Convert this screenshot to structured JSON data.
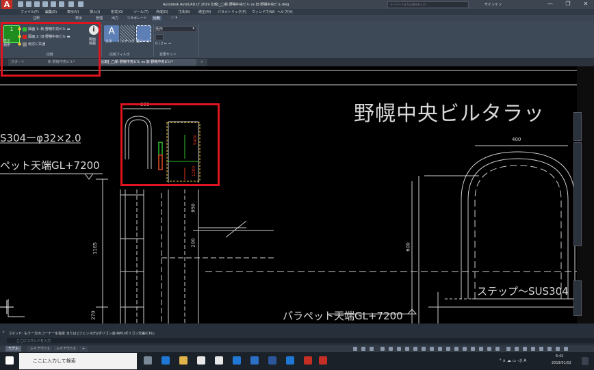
{
  "window": {
    "title": "Autodesk AutoCAD LT 2019   比較[_◯新-野幌中央ビル vs 旧-野幌中央ビル.dwg",
    "search_placeholder": "キーワードまたは語句を入力",
    "signin": "サインイン",
    "controls": [
      "—",
      "❐",
      "✕"
    ]
  },
  "menu": [
    "ファイル(F)",
    "編集(E)",
    "表示(V)",
    "挿入(I)",
    "形式(O)",
    "ツール(T)",
    "作成(D)",
    "寸法(N)",
    "修正(M)",
    "パラメトリック(P)",
    "ウィンドウ(W)",
    "ヘルプ(H)"
  ],
  "ribbon_tabs": [
    "注釈",
    "表示",
    "管理",
    "出力",
    "コラボレート",
    "比較"
  ],
  "ribbon": {
    "compare_panel": {
      "toggle_label": "表示\n順序",
      "drawing1": "図面 1: 新-野幌中央ビル",
      "drawing2": "図面 2: 旧-野幌中央ビル",
      "both": "両方に共通",
      "info_label": "図面\n情報",
      "panel_title": "比較",
      "colors": {
        "drawing1": "#2fbf2f",
        "drawing2": "#d8231a",
        "both": "#888888"
      }
    },
    "filter_panel": {
      "text_label": "文字",
      "hatch_label": "ハッチング",
      "revcloud_label": "雲マーク",
      "panel_title": "比較フィルタ"
    },
    "changeset_panel": {
      "shape_value": "矩形",
      "counter": "0 / 2",
      "panel_title": "変更セット"
    }
  },
  "doc_tabs": [
    {
      "label": "スタート",
      "active": false
    },
    {
      "label": "新-野幌中央ビル*",
      "active": false
    },
    {
      "label": "比較[_◯新-野幌中央ビル vs 旧-野幌中央ビル*",
      "active": true
    }
  ],
  "drawing": {
    "title_text": "野幌中央ビルタラッ",
    "leader_text": "S304ーφ32×2.0",
    "parapet_left": "ペット天端GL+7200",
    "parapet_bottom": "パラペット天端GL+7200",
    "step_text": "ステップ～SUS304",
    "dims": [
      "300",
      "5400",
      "1200",
      "950",
      "200",
      "1165",
      "270",
      "400",
      "600"
    ]
  },
  "command": {
    "history": "コマンド: もう一方のコーナーを指定 または [フェンス(F)/ポリゴン窓(WP)/ポリゴン交差(CP)]:",
    "input_placeholder": "ここにコマンドを入力"
  },
  "layout_tabs": [
    "モデル",
    "レイアウト1",
    "レイアウト2"
  ],
  "taskbar": {
    "search_placeholder": "ここに入力して検索",
    "time": "6:42",
    "date": "2019/01/02"
  }
}
